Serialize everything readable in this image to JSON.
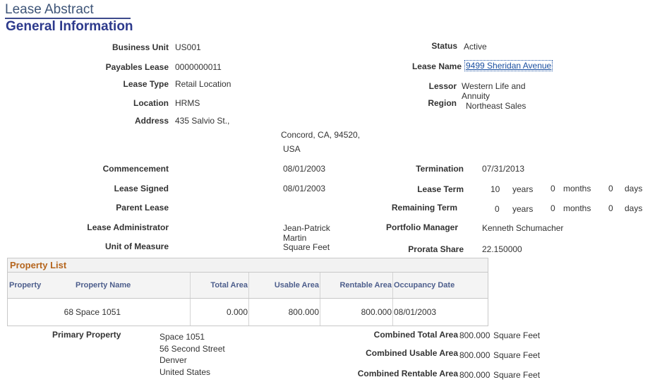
{
  "page_title": "Lease Abstract",
  "section_title": "General Information",
  "fields": {
    "business_unit": {
      "label": "Business Unit",
      "value": "US001"
    },
    "status": {
      "label": "Status",
      "value": "Active"
    },
    "payables_lease": {
      "label": "Payables Lease",
      "value": "0000000011"
    },
    "lease_name": {
      "label": "Lease Name",
      "value": "9499 Sheridan Avenue"
    },
    "lease_type": {
      "label": "Lease Type",
      "value": "Retail Location"
    },
    "lessor": {
      "label": "Lessor",
      "value_line1": "Western Life and",
      "value_line2": "Annuity"
    },
    "location": {
      "label": "Location",
      "value": "HRMS"
    },
    "region": {
      "label": "Region",
      "value": "Northeast Sales"
    },
    "address": {
      "label": "Address",
      "line1": "435 Salvio St.,",
      "line2": "Concord, CA, 94520,",
      "line3": "USA"
    },
    "commencement": {
      "label": "Commencement",
      "value": "08/01/2003"
    },
    "termination": {
      "label": "Termination",
      "value": "07/31/2013"
    },
    "lease_signed": {
      "label": "Lease Signed",
      "value": "08/01/2003"
    },
    "lease_term": {
      "label": "Lease Term",
      "years": "10",
      "months": "0",
      "days": "0"
    },
    "parent_lease": {
      "label": "Parent Lease"
    },
    "remaining_term": {
      "label": "Remaining Term",
      "years": "0",
      "months": "0",
      "days": "0"
    },
    "lease_administrator": {
      "label": "Lease Administrator",
      "value_line1": "Jean-Patrick",
      "value_line2": "Martin"
    },
    "portfolio_manager": {
      "label": "Portfolio Manager",
      "value": "Kenneth Schumacher"
    },
    "unit_of_measure": {
      "label": "Unit of Measure",
      "value": "Square Feet"
    },
    "prorata_share": {
      "label": "Prorata Share",
      "value": "22.150000"
    }
  },
  "units": {
    "years": "years",
    "months": "months",
    "days": "days"
  },
  "property_list": {
    "title": "Property List",
    "columns": [
      "Property",
      "Property Name",
      "Total Area",
      "Usable Area",
      "Rentable Area",
      "Occupancy Date"
    ],
    "rows": [
      {
        "property": "68",
        "property_name": "Space 1051",
        "total_area": "0.000",
        "usable_area": "800.000",
        "rentable_area": "800.000",
        "occupancy_date": "08/01/2003"
      }
    ]
  },
  "primary_property": {
    "label": "Primary Property",
    "lines": [
      "Space 1051",
      "56 Second Street",
      "Denver",
      "United States"
    ]
  },
  "combined": {
    "total": {
      "label": "Combined Total Area",
      "value": "800.000",
      "unit": "Square Feet"
    },
    "usable": {
      "label": "Combined Usable Area",
      "value": "800.000",
      "unit": "Square Feet"
    },
    "rentable": {
      "label": "Combined Rentable Area",
      "value": "800.000",
      "unit": "Square Feet"
    }
  }
}
